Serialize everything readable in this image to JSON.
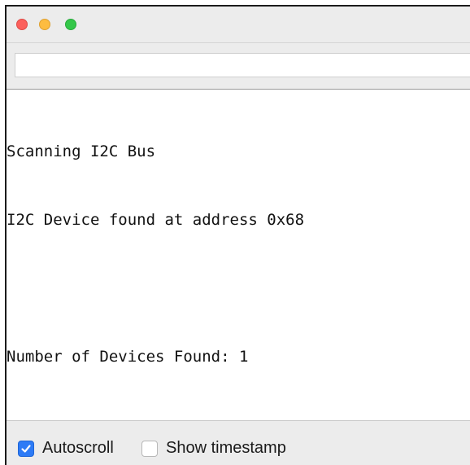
{
  "window": {
    "traffic_lights": {
      "close_color": "#fc605c",
      "minimize_color": "#fdbc40",
      "zoom_color": "#34c749"
    }
  },
  "input": {
    "value": "",
    "placeholder": ""
  },
  "output": {
    "lines": [
      "Scanning I2C Bus",
      "I2C Device found at address 0x68",
      "",
      "Number of Devices Found: 1"
    ]
  },
  "footer": {
    "autoscroll": {
      "label": "Autoscroll",
      "checked": true,
      "icon": "checkmark-icon"
    },
    "show_timestamp": {
      "label": "Show timestamp",
      "checked": false
    }
  },
  "colors": {
    "checkbox_accent": "#2d7bf6",
    "chrome_background": "#ececec"
  }
}
